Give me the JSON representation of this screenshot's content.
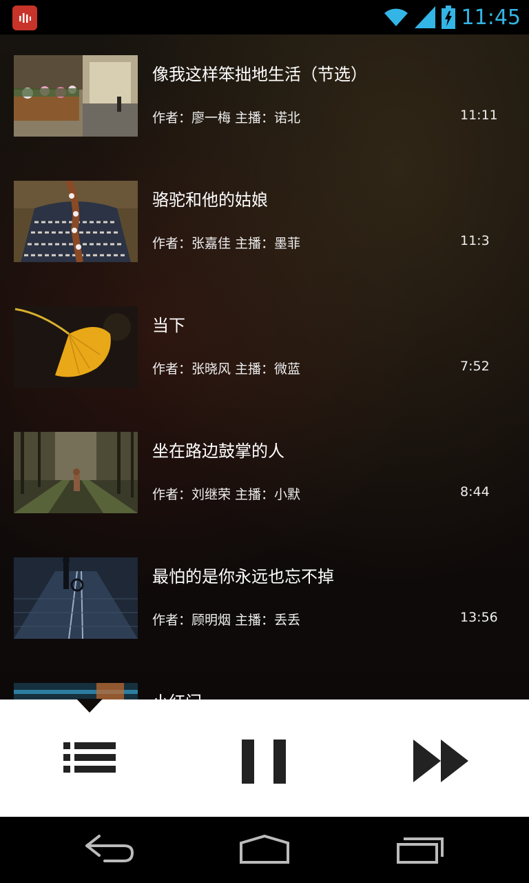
{
  "status_bar": {
    "time": "11:45",
    "icons": [
      "app-notification-icon",
      "wifi-icon",
      "cell-signal-icon",
      "battery-charging-icon"
    ]
  },
  "playlist": [
    {
      "title": "像我这样笨拙地生活（节选）",
      "meta": "作者：廖一梅 主播：诺北",
      "duration": "11:11",
      "thumb": "street-flowers"
    },
    {
      "title": "骆驼和他的姑娘",
      "meta": "作者：张嘉佳 主播：墨菲",
      "duration": "11:3",
      "thumb": "braided-hair"
    },
    {
      "title": "当下",
      "meta": "作者：张晓风 主播：微蓝",
      "duration": "7:52",
      "thumb": "ginkgo-leaf"
    },
    {
      "title": "坐在路边鼓掌的人",
      "meta": "作者：刘继荣 主播：小默",
      "duration": "8:44",
      "thumb": "forest-path"
    },
    {
      "title": "最怕的是你永远也忘不掉",
      "meta": "作者：顾明烟 主播：丢丢",
      "duration": "13:56",
      "thumb": "rainy-street"
    },
    {
      "title": "小红门",
      "meta": "",
      "duration": "",
      "thumb": "blue-city"
    }
  ],
  "player": {
    "buttons": [
      "playlist-icon",
      "pause-icon",
      "next-icon"
    ]
  },
  "nav": {
    "buttons": [
      "back-icon",
      "home-icon",
      "recents-icon"
    ]
  },
  "colors": {
    "accent": "#33b5e5",
    "app_icon": "#c8342a",
    "player_bg": "#ffffff",
    "player_icons": "#222222"
  }
}
